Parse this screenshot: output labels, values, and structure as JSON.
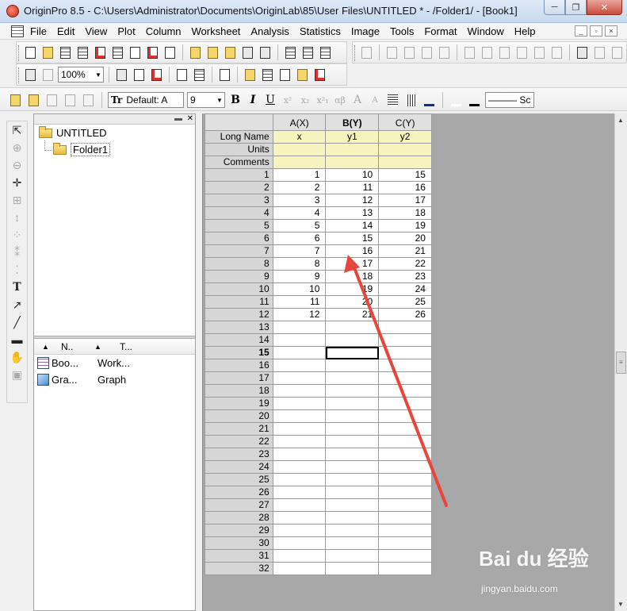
{
  "window": {
    "title": "OriginPro 8.5 - C:\\Users\\Administrator\\Documents\\OriginLab\\85\\User Files\\UNTITLED * - /Folder1/ - [Book1]",
    "minimize": "─",
    "restore": "❐",
    "close": "✕"
  },
  "menu": {
    "items": [
      "File",
      "Edit",
      "View",
      "Plot",
      "Column",
      "Worksheet",
      "Analysis",
      "Statistics",
      "Image",
      "Tools",
      "Format",
      "Window",
      "Help"
    ],
    "mdi_minimize": "_",
    "mdi_restore": "▫",
    "mdi_close": "×"
  },
  "toolbar": {
    "zoom": "100%"
  },
  "format_bar": {
    "font_prefix": "Tr",
    "font": "Default: A",
    "size": "9",
    "bold": "B",
    "italic": "I",
    "underline": "U",
    "superscript": "x²",
    "subscript": "x₂",
    "supsub": "x²₁",
    "greek": "αβ",
    "grow": "A",
    "shrink": "A",
    "line_style": "——— Sc"
  },
  "explorer": {
    "root": "UNTITLED",
    "folder": "Folder1",
    "columns": [
      "N..",
      "T..."
    ],
    "items": [
      {
        "name": "Boo...",
        "type": "Work...",
        "icon": "workbook-icon"
      },
      {
        "name": "Gra...",
        "type": "Graph",
        "icon": "graph-icon"
      }
    ]
  },
  "worksheet": {
    "columns": [
      "A(X)",
      "B(Y)",
      "C(Y)"
    ],
    "meta_rows": [
      {
        "label": "Long Name",
        "values": [
          "x",
          "y1",
          "y2"
        ]
      },
      {
        "label": "Units",
        "values": [
          "",
          "",
          ""
        ]
      },
      {
        "label": "Comments",
        "values": [
          "",
          "",
          ""
        ]
      }
    ],
    "rows": [
      {
        "n": "1",
        "v": [
          "1",
          "10",
          "15"
        ]
      },
      {
        "n": "2",
        "v": [
          "2",
          "11",
          "16"
        ]
      },
      {
        "n": "3",
        "v": [
          "3",
          "12",
          "17"
        ]
      },
      {
        "n": "4",
        "v": [
          "4",
          "13",
          "18"
        ]
      },
      {
        "n": "5",
        "v": [
          "5",
          "14",
          "19"
        ]
      },
      {
        "n": "6",
        "v": [
          "6",
          "15",
          "20"
        ]
      },
      {
        "n": "7",
        "v": [
          "7",
          "16",
          "21"
        ]
      },
      {
        "n": "8",
        "v": [
          "8",
          "17",
          "22"
        ]
      },
      {
        "n": "9",
        "v": [
          "9",
          "18",
          "23"
        ]
      },
      {
        "n": "10",
        "v": [
          "10",
          "19",
          "24"
        ]
      },
      {
        "n": "11",
        "v": [
          "11",
          "20",
          "25"
        ]
      },
      {
        "n": "12",
        "v": [
          "12",
          "21",
          "26"
        ]
      },
      {
        "n": "13",
        "v": [
          "",
          "",
          ""
        ]
      },
      {
        "n": "14",
        "v": [
          "",
          "",
          ""
        ]
      },
      {
        "n": "15",
        "v": [
          "",
          "",
          ""
        ]
      },
      {
        "n": "16",
        "v": [
          "",
          "",
          ""
        ]
      },
      {
        "n": "17",
        "v": [
          "",
          "",
          ""
        ]
      },
      {
        "n": "18",
        "v": [
          "",
          "",
          ""
        ]
      },
      {
        "n": "19",
        "v": [
          "",
          "",
          ""
        ]
      },
      {
        "n": "20",
        "v": [
          "",
          "",
          ""
        ]
      },
      {
        "n": "21",
        "v": [
          "",
          "",
          ""
        ]
      },
      {
        "n": "22",
        "v": [
          "",
          "",
          ""
        ]
      },
      {
        "n": "23",
        "v": [
          "",
          "",
          ""
        ]
      },
      {
        "n": "24",
        "v": [
          "",
          "",
          ""
        ]
      },
      {
        "n": "25",
        "v": [
          "",
          "",
          ""
        ]
      },
      {
        "n": "26",
        "v": [
          "",
          "",
          ""
        ]
      },
      {
        "n": "27",
        "v": [
          "",
          "",
          ""
        ]
      },
      {
        "n": "28",
        "v": [
          "",
          "",
          ""
        ]
      },
      {
        "n": "29",
        "v": [
          "",
          "",
          ""
        ]
      },
      {
        "n": "30",
        "v": [
          "",
          "",
          ""
        ]
      },
      {
        "n": "31",
        "v": [
          "",
          "",
          ""
        ]
      },
      {
        "n": "32",
        "v": [
          "",
          "",
          ""
        ]
      }
    ],
    "active_row": "15",
    "selected_column": "B(Y)"
  },
  "annotation_color": "#e8453c",
  "watermark": {
    "brand": "Bai du 经验",
    "url": "jingyan.baidu.com"
  }
}
